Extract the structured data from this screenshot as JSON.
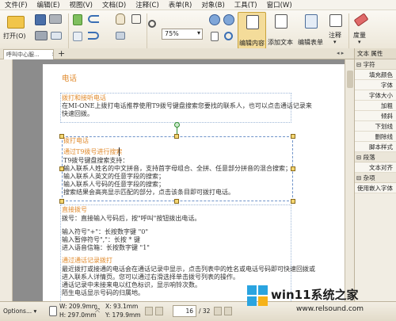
{
  "menu": [
    "文件(F)",
    "编辑(E)",
    "视图(V)",
    "文档(D)",
    "注释(C)",
    "表单(R)",
    "对象(B)",
    "工具(T)",
    "窗口(W)"
  ],
  "toolbar": {
    "open_label": "打开(O)",
    "zoom_value": "75%",
    "edit_content_label": "编辑内容",
    "add_text_label": "添加文本",
    "edit_form_label": "编辑表单",
    "comment_label": "注释",
    "measure_label": "度量"
  },
  "tabs": {
    "doc_label": "呼叫中心服..."
  },
  "document": {
    "section_title": "电话",
    "p1_title": "拨打和接听电话",
    "p1_body": [
      "在MI-ONE上拨打电话推荐使用T9拨号键盘搜索您要找的联系人，也可以点击通话记录来",
      "快速回拨。"
    ],
    "p2_heading": "拨打电话",
    "p2_title": "通过T9拨号进行搜索",
    "p2_body": [
      "T9拨号键盘搜索支持：",
      "输入联系人姓名的中文拼音，支持首字母组合、全拼、任意部分拼音的混合搜索；",
      "输入联系人英文的任意字段的搜索；",
      "输入联系人号码的任意字段的搜索；",
      "搜索结果会高亮显示匹配的部分，点击该条目即可拨打电话。"
    ],
    "p3_heading": "直接拨号",
    "p3_body": [
      "拨号：直接输入号码后，按\"呼叫\"按钮拨出电话。",
      "",
      "输入符号\"+\"：长按数字键 \"0\"",
      "输入暂停符号\",\"：长按 * 键",
      "进入语音信箱：长按数字键 \"1\""
    ],
    "p4_title": "通过通话记录拨打",
    "p4_body": [
      "最近拨打或接通的电话会在通话记录中显示，点击列表中的姓名或电话号码即可快速回拨或",
      "进入联系人详情页。您可以通过右滑选择单击拨号列表的操作。",
      "通话记录中未接来电以红色标识，显示响铃次数。",
      "陌生电话显示号码的归属地。"
    ]
  },
  "right_panel": {
    "title": "文本 属性",
    "section_font": "字符",
    "rows_font": [
      "填充颜色",
      "字体",
      "字体大小",
      "加粗",
      "倾斜",
      "下划线",
      "删除线",
      "脚本样式"
    ],
    "section_para": "段落",
    "rows_para": [
      "文本对齐"
    ],
    "section_misc": "杂项",
    "rows_misc": [
      "使用嵌入字体"
    ]
  },
  "statusbar": {
    "options_label": "Options...",
    "w_value": "W: 209.9mm",
    "h_value": "H: 297.0mm",
    "x_value": "X: 93.1mm",
    "y_value": "Y: 179.9mm",
    "current_page": "16",
    "total_pages": "/ 32",
    "watermark": "win11系统之家",
    "watermark_url": "www.relsound.com"
  },
  "colors": {
    "accent_orange": "#e08a2c",
    "selection_blue": "#6f93c9",
    "red_arrow": "#e0251f"
  }
}
